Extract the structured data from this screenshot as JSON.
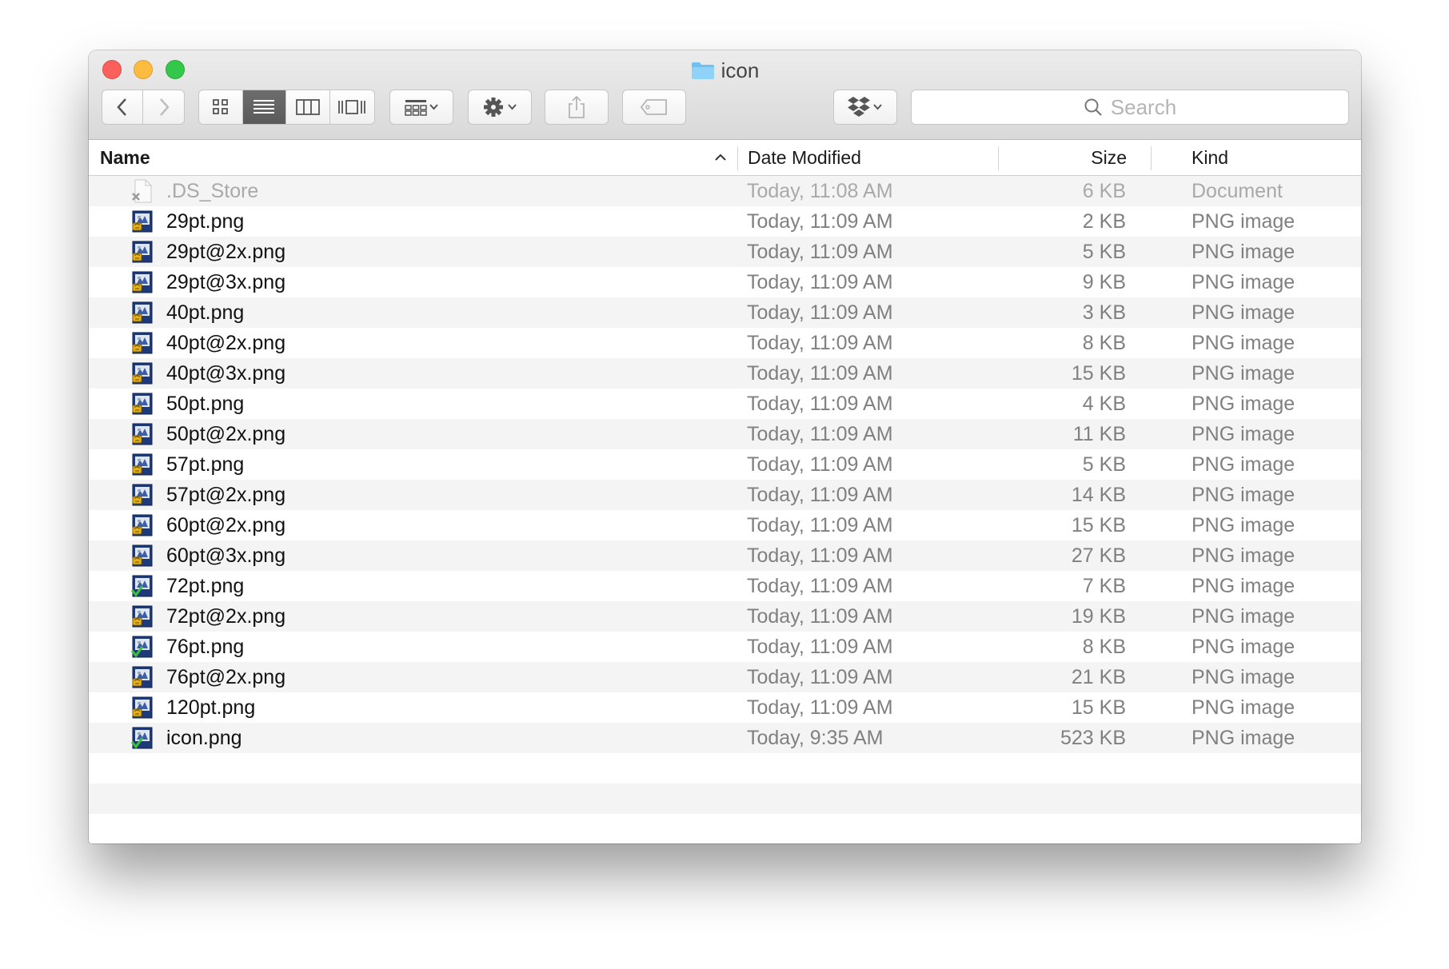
{
  "window": {
    "title": "icon"
  },
  "toolbar": {
    "back_icon": "chevron-left-icon",
    "forward_icon": "chevron-right-icon",
    "views": [
      "icon-view-icon",
      "list-view-icon",
      "column-view-icon",
      "cover-flow-icon"
    ],
    "active_view": "list",
    "arrange_icon": "arrange-grid-icon",
    "action_icon": "gear-icon",
    "share_icon": "share-icon",
    "tag_icon": "tag-icon",
    "dropbox_icon": "dropbox-icon",
    "search_placeholder": "Search"
  },
  "columns": {
    "name": "Name",
    "date": "Date Modified",
    "size": "Size",
    "kind": "Kind",
    "sort_indicator": "chevron-up-icon"
  },
  "files": [
    {
      "name": ".DS_Store",
      "date": "Today, 11:08 AM",
      "size": "6 KB",
      "kind": "Document",
      "icon": "blank-doc-icon",
      "dimmed": true
    },
    {
      "name": "29pt.png",
      "date": "Today, 11:09 AM",
      "size": "2 KB",
      "kind": "PNG image",
      "icon": "png-preview-icon"
    },
    {
      "name": "29pt@2x.png",
      "date": "Today, 11:09 AM",
      "size": "5 KB",
      "kind": "PNG image",
      "icon": "png-preview-icon"
    },
    {
      "name": "29pt@3x.png",
      "date": "Today, 11:09 AM",
      "size": "9 KB",
      "kind": "PNG image",
      "icon": "png-preview-icon"
    },
    {
      "name": "40pt.png",
      "date": "Today, 11:09 AM",
      "size": "3 KB",
      "kind": "PNG image",
      "icon": "png-preview-icon"
    },
    {
      "name": "40pt@2x.png",
      "date": "Today, 11:09 AM",
      "size": "8 KB",
      "kind": "PNG image",
      "icon": "png-preview-icon"
    },
    {
      "name": "40pt@3x.png",
      "date": "Today, 11:09 AM",
      "size": "15 KB",
      "kind": "PNG image",
      "icon": "png-preview-icon"
    },
    {
      "name": "50pt.png",
      "date": "Today, 11:09 AM",
      "size": "4 KB",
      "kind": "PNG image",
      "icon": "png-preview-icon"
    },
    {
      "name": "50pt@2x.png",
      "date": "Today, 11:09 AM",
      "size": "11 KB",
      "kind": "PNG image",
      "icon": "png-preview-icon"
    },
    {
      "name": "57pt.png",
      "date": "Today, 11:09 AM",
      "size": "5 KB",
      "kind": "PNG image",
      "icon": "png-preview-icon"
    },
    {
      "name": "57pt@2x.png",
      "date": "Today, 11:09 AM",
      "size": "14 KB",
      "kind": "PNG image",
      "icon": "png-preview-icon"
    },
    {
      "name": "60pt@2x.png",
      "date": "Today, 11:09 AM",
      "size": "15 KB",
      "kind": "PNG image",
      "icon": "png-preview-icon"
    },
    {
      "name": "60pt@3x.png",
      "date": "Today, 11:09 AM",
      "size": "27 KB",
      "kind": "PNG image",
      "icon": "png-preview-icon"
    },
    {
      "name": "72pt.png",
      "date": "Today, 11:09 AM",
      "size": "7 KB",
      "kind": "PNG image",
      "icon": "png-preview-check-icon"
    },
    {
      "name": "72pt@2x.png",
      "date": "Today, 11:09 AM",
      "size": "19 KB",
      "kind": "PNG image",
      "icon": "png-preview-icon"
    },
    {
      "name": "76pt.png",
      "date": "Today, 11:09 AM",
      "size": "8 KB",
      "kind": "PNG image",
      "icon": "png-preview-check-icon"
    },
    {
      "name": "76pt@2x.png",
      "date": "Today, 11:09 AM",
      "size": "21 KB",
      "kind": "PNG image",
      "icon": "png-preview-icon"
    },
    {
      "name": "120pt.png",
      "date": "Today, 11:09 AM",
      "size": "15 KB",
      "kind": "PNG image",
      "icon": "png-preview-icon"
    },
    {
      "name": "icon.png",
      "date": "Today, 9:35 AM",
      "size": "523 KB",
      "kind": "PNG image",
      "icon": "png-preview-check-icon"
    }
  ],
  "empty_rows": 3
}
